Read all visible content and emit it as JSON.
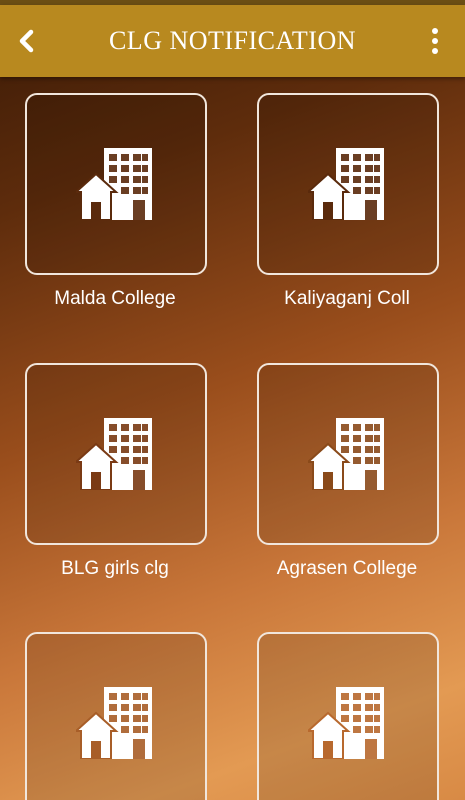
{
  "appbar": {
    "title": "CLG NOTIFICATION",
    "back_icon": "chevron-left-icon",
    "menu_icon": "more-vertical-icon"
  },
  "colors": {
    "appbar": "#b8891f",
    "tile_border": "#f1e6dc",
    "text": "#ffffff"
  },
  "colleges": [
    {
      "name": "Malda College",
      "icon": "building-icon"
    },
    {
      "name": "Kaliyaganj Coll",
      "icon": "building-icon"
    },
    {
      "name": "BLG girls clg",
      "icon": "building-icon"
    },
    {
      "name": "Agrasen College",
      "icon": "building-icon"
    },
    {
      "name": "",
      "icon": "building-icon"
    },
    {
      "name": "",
      "icon": "building-icon"
    }
  ]
}
